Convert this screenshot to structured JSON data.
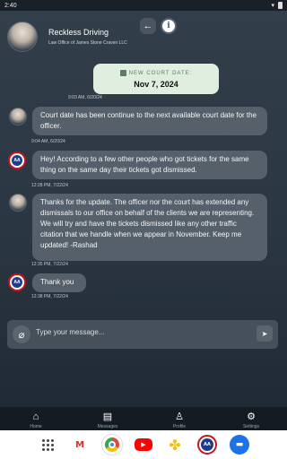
{
  "status_bar": {
    "time": "2:40",
    "wifi_icon": "wifi-icon",
    "battery_icon": "battery-icon"
  },
  "header": {
    "title": "Reckless Driving",
    "subtitle": "Law Office of James Stone Craven LLC",
    "back_icon": "arrow-left-icon",
    "info_icon": "info-icon"
  },
  "court_card": {
    "label": "NEW COURT DATE:",
    "date": "Nov 7, 2024",
    "timestamp": "9:03 AM, 6/20/24",
    "icon": "calendar-icon",
    "background": "#dfeede"
  },
  "messages": [
    {
      "sender": "attorney",
      "text": "Court date has been continue to the next available court date for the officer.",
      "timestamp": "9:04 AM, 6/20/24"
    },
    {
      "sender": "client",
      "text": "Hey! According to a few other people who got tickets for the same thing on the same day their tickets got dismissed.",
      "timestamp": "12:28 PM, 7/22/24"
    },
    {
      "sender": "attorney",
      "text": "Thanks for the update. The officer nor the court has extended any dismissals to our office on behalf of the clients we are representing. We will try and have the tickets dismissed like any other traffic citation that we handle when we appear in November. Keep me updated! -Rashad",
      "timestamp": "12:35 PM, 7/22/24"
    },
    {
      "sender": "client",
      "text": "Thank you",
      "timestamp": "12:38 PM, 7/22/24"
    }
  ],
  "composer": {
    "placeholder": "Type your message...",
    "attach_icon": "paperclip-icon",
    "send_icon": "send-icon"
  },
  "bottom_nav": [
    {
      "icon": "home-icon",
      "label": "Home"
    },
    {
      "icon": "inbox-icon",
      "label": "Messages"
    },
    {
      "icon": "person-icon",
      "label": "Profile"
    },
    {
      "icon": "gear-icon",
      "label": "Settings"
    }
  ],
  "dock": [
    {
      "icon": "app-drawer-icon"
    },
    {
      "icon": "gmail-icon"
    },
    {
      "icon": "chrome-icon"
    },
    {
      "icon": "youtube-icon"
    },
    {
      "icon": "photos-icon"
    },
    {
      "icon": "aa-app-icon",
      "label": "AA"
    },
    {
      "icon": "messages-icon"
    }
  ],
  "colors": {
    "accent_bubble": "#55606a",
    "court_card_text": "#5d7b60",
    "logo_red": "#c8141b",
    "logo_blue": "#1d3c8a"
  }
}
